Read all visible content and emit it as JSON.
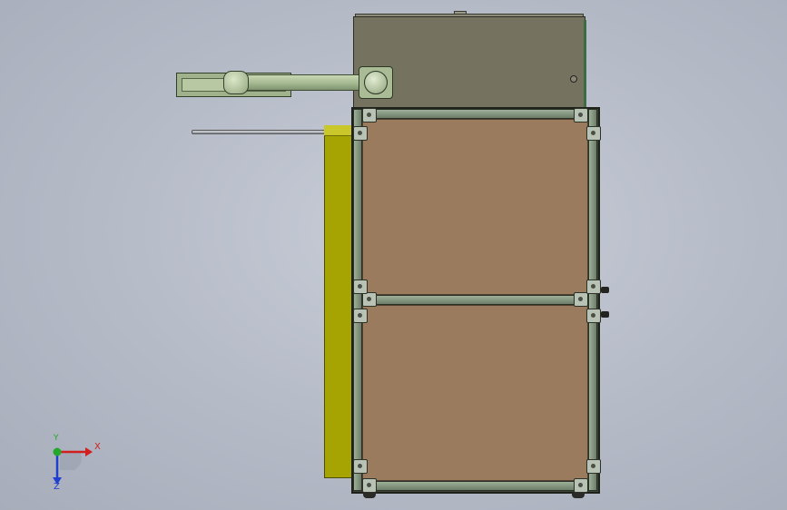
{
  "viewport": {
    "triad": {
      "x_label": "X",
      "y_label": "Y",
      "z_label": "Z"
    }
  },
  "colors": {
    "background": "#b4bac6",
    "cabinet": "#75725f",
    "panel": "#9a7b5d",
    "side_panel": "#a6a403",
    "arm": "#a4b891",
    "frame": "#3f4237",
    "axis_x": "#d11f1f",
    "axis_y": "#22a82a",
    "axis_z": "#1f3fd1"
  }
}
